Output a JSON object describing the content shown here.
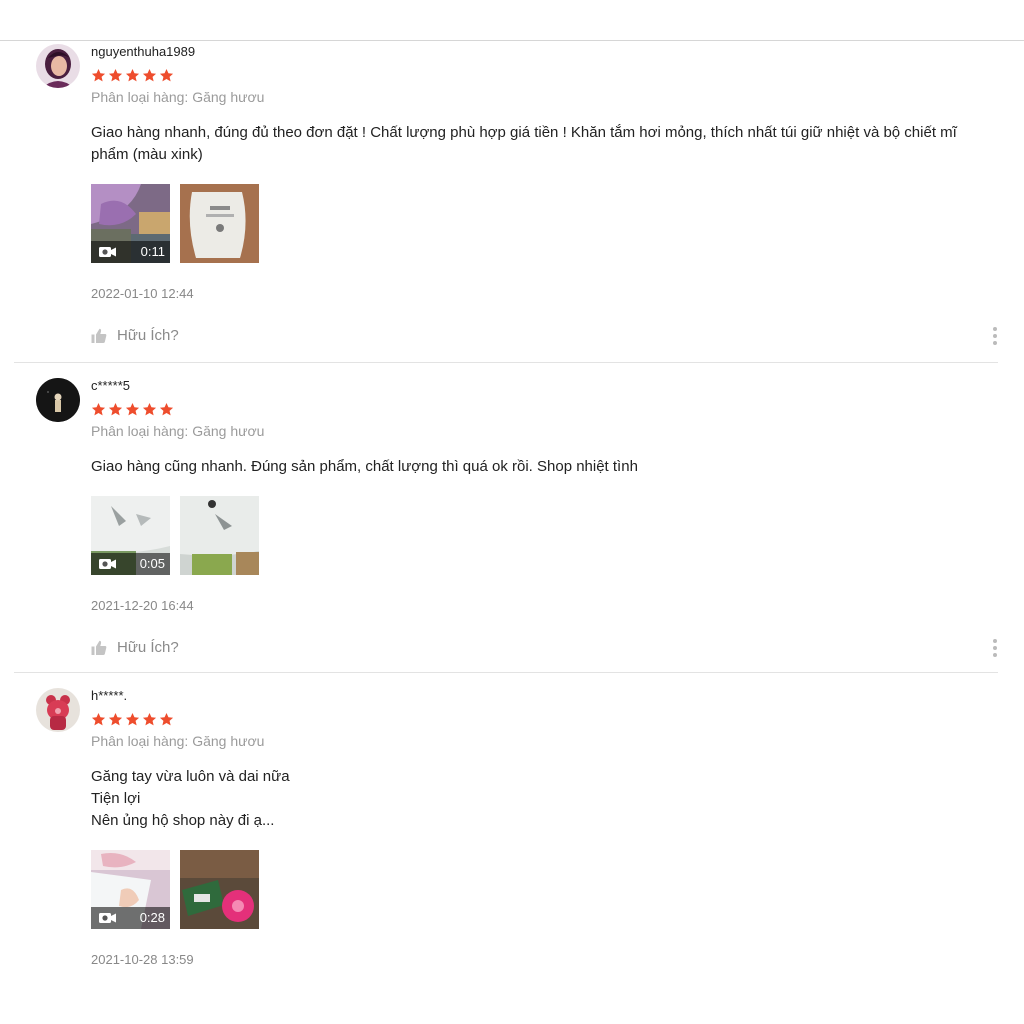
{
  "reviews": [
    {
      "username": "nguyenthuha1989",
      "rating": 5,
      "variation": "Phân loại hàng: Găng hươu",
      "comment_lines": [
        "Giao hàng nhanh, đúng đủ theo đơn đặt ! Chất lượng phù hợp giá tiền ! Khăn tắm hơi mỏng, thích nhất túi giữ nhiệt và bộ chiết mĩ phẩm (màu xink)"
      ],
      "video_duration": "0:11",
      "time": "2022-01-10 12:44",
      "helpful_label": "Hữu Ích?"
    },
    {
      "username": "c*****5",
      "rating": 5,
      "variation": "Phân loại hàng: Găng hươu",
      "comment_lines": [
        "Giao hàng cũng nhanh. Đúng sản phẩm, chất lượng thì quá ok rồi. Shop nhiệt tình"
      ],
      "video_duration": "0:05",
      "time": "2021-12-20 16:44",
      "helpful_label": "Hữu Ích?"
    },
    {
      "username": "h*****.",
      "rating": 5,
      "variation": "Phân loại hàng: Găng hươu",
      "comment_lines": [
        "Găng tay vừa luôn và dai nữa",
        "Tiện lợi",
        "Nên ủng hộ shop này đi ạ..."
      ],
      "video_duration": "0:28",
      "time": "2021-10-28 13:59"
    }
  ],
  "colors": {
    "star": "#ee4d2d",
    "muted_text": "#9b9b9b",
    "divider": "#e3e3e3"
  },
  "icons": {
    "star": "star-icon",
    "video": "video-camera-icon",
    "helpful": "thumbs-up-icon",
    "more": "more-vertical-icon"
  }
}
